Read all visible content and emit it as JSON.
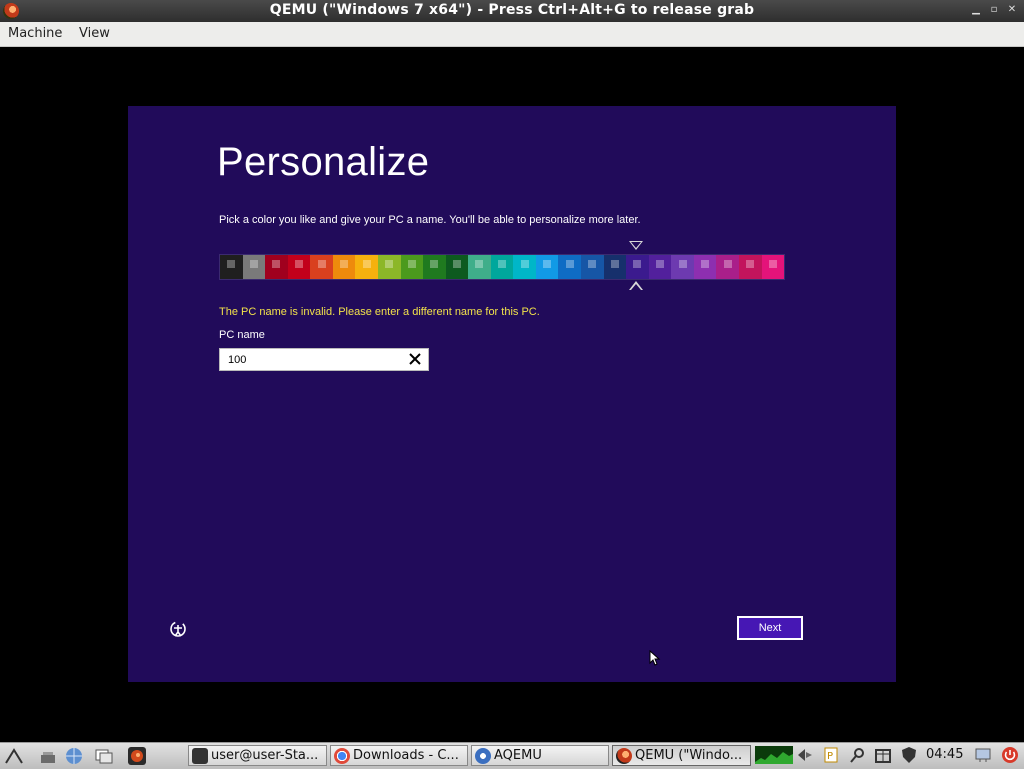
{
  "window": {
    "title": "QEMU (\"Windows 7 x64\") - Press Ctrl+Alt+G to release grab",
    "controls": [
      "minimize",
      "restore",
      "close"
    ]
  },
  "menubar": {
    "items": [
      {
        "label": "Machine"
      },
      {
        "label": "View"
      }
    ]
  },
  "setup": {
    "heading": "Personalize",
    "subtitle": "Pick a color you like and give your PC a name. You'll be able to personalize more later.",
    "palette_colors": [
      "#1f1f1f",
      "#7a7a7a",
      "#a0001e",
      "#c2001b",
      "#d9401e",
      "#ee8a0c",
      "#f6b10e",
      "#8cb728",
      "#4b9a1d",
      "#1f7a1f",
      "#0d5a1f",
      "#3fae8a",
      "#00a79c",
      "#00b6c8",
      "#119ae6",
      "#0f6cc4",
      "#1656a6",
      "#16306c",
      "#3b1a8e",
      "#52209c",
      "#6d3ab0",
      "#8d2fb0",
      "#a91f8a",
      "#c2145c",
      "#e4137a"
    ],
    "selected_color_index": 18,
    "error_message": "The PC name is invalid. Please enter a different name for this PC.",
    "pc_name_label": "PC name",
    "pc_name_value": "100",
    "next_label": "Next"
  },
  "taskbar": {
    "tasks": [
      {
        "label": "user@user-Sta...",
        "icon": "terminal-icon"
      },
      {
        "label": "Downloads - C...",
        "icon": "chrome-icon"
      },
      {
        "label": "AQEMU",
        "icon": "aqemu-icon"
      },
      {
        "label": "QEMU (\"Windo...",
        "icon": "qemu-icon"
      }
    ],
    "clock": "04:45"
  }
}
